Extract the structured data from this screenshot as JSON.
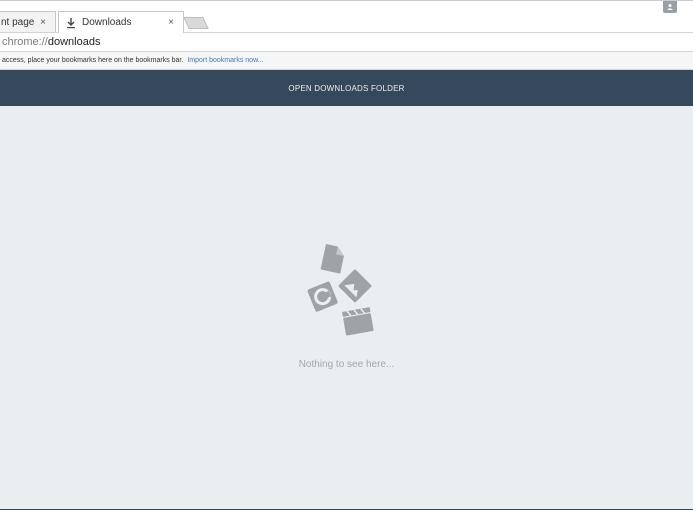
{
  "tabs": [
    {
      "title": "nt page of",
      "close": "×"
    },
    {
      "title": "Downloads",
      "close": "×"
    }
  ],
  "omnibox": {
    "scheme": "chrome://",
    "path": "downloads"
  },
  "bookmarks_bar": {
    "message": "access, place your bookmarks here on the bookmarks bar.",
    "link": "Import bookmarks now..."
  },
  "header": {
    "open_folder_label": "OPEN DOWNLOADS FOLDER"
  },
  "main": {
    "empty_text": "Nothing to see here..."
  },
  "colors": {
    "header_bg": "#36495c",
    "page_bg": "#ebeef1",
    "link": "#3c78c6"
  }
}
